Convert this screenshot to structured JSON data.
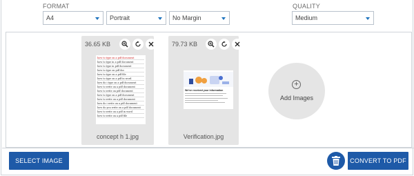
{
  "options": {
    "format_label": "FORMAT",
    "quality_label": "QUALITY",
    "page_size": "A4",
    "orientation": "Portrait",
    "margin": "No Margin",
    "quality": "Medium"
  },
  "images": [
    {
      "size": "36.65 KB",
      "filename": "concept h 1.jpg",
      "lines": [
        "how to type on a pdf document",
        "how to type in a pdf document",
        "how to type in pdf document",
        "how to type on pdf doc",
        "how to type on a pdf file",
        "how to type on a pdf in word",
        "how do i type on a pdf document",
        "how to write on a pdf document",
        "how to write on pdf document",
        "how to type on a pdf document",
        "how to write on a pdf document",
        "how do i write on a pdf document",
        "how do you write on a pdf document",
        "how to write on a pdf in word",
        "how to write on a pdf file"
      ]
    },
    {
      "size": "79.73 KB",
      "filename": "Verification.jpg",
      "heading": "We've received your information"
    }
  ],
  "tools": {
    "zoom_icon": "zoom-in-icon",
    "rotate_icon": "rotate-icon",
    "remove_icon": "close-icon"
  },
  "add_images": {
    "label": "Add Images"
  },
  "footer": {
    "select_label": "SELECT IMAGE",
    "convert_label": "CONVERT TO PDF"
  },
  "colors": {
    "accent": "#1e5aa8",
    "card_bg": "#e5e5e5",
    "red_text": "#cc2222"
  }
}
